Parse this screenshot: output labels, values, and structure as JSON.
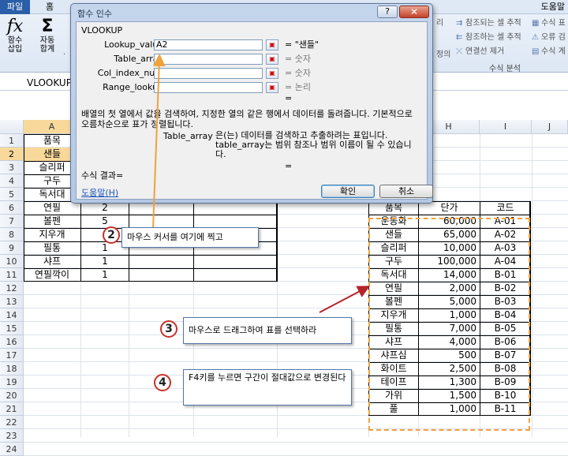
{
  "ribbon": {
    "tabs": {
      "file": "파일",
      "home": "홈",
      "help": "도움말"
    },
    "insert_function": [
      "함수",
      "삽입"
    ],
    "autosum": [
      "자동",
      "합계"
    ],
    "autosum_more": "·",
    "ribbon_stub_top": "리",
    "ribbon_stub_bottom": "정의",
    "trace_precedents": "참조되는 셀 추적",
    "trace_dependents": "참조하는 셀 추적",
    "remove_arrows": "연결선 제거",
    "show_formulas": "수식 표",
    "error_checking": "오류 검",
    "evaluate_formula": "수식 계",
    "group_label": "수식 분석"
  },
  "formula_bar": {
    "name_box": "VLOOKUP"
  },
  "columns": [
    "A",
    "H",
    "I",
    "J"
  ],
  "rows": [
    "1",
    "2",
    "3",
    "4",
    "5",
    "6",
    "7",
    "8",
    "9",
    "10",
    "11",
    "12",
    "13",
    "14",
    "15",
    "16",
    "17",
    "18",
    "19",
    "20",
    "21",
    "22",
    "23",
    "24"
  ],
  "table1": {
    "a": [
      "품목",
      "샌들",
      "슬리퍼",
      "구두",
      "독서대",
      "연필",
      "볼펜",
      "지우개",
      "필통",
      "샤프",
      "연필깍이"
    ],
    "b": [
      "2",
      "5",
      "",
      "1",
      "1",
      "1"
    ]
  },
  "table2": {
    "headers": [
      "품목",
      "단가",
      "코드"
    ],
    "rows": [
      [
        "운동화",
        "60,000",
        "A-01"
      ],
      [
        "샌들",
        "65,000",
        "A-02"
      ],
      [
        "슬리퍼",
        "10,000",
        "A-03"
      ],
      [
        "구두",
        "100,000",
        "A-04"
      ],
      [
        "독서대",
        "14,000",
        "B-01"
      ],
      [
        "연필",
        "2,000",
        "B-02"
      ],
      [
        "볼펜",
        "5,000",
        "B-03"
      ],
      [
        "지우개",
        "1,000",
        "B-04"
      ],
      [
        "필통",
        "7,000",
        "B-05"
      ],
      [
        "샤프",
        "4,000",
        "B-06"
      ],
      [
        "샤프심",
        "500",
        "B-07"
      ],
      [
        "화이트",
        "2,500",
        "B-08"
      ],
      [
        "테이프",
        "1,300",
        "B-09"
      ],
      [
        "가위",
        "1,500",
        "B-10"
      ],
      [
        "풀",
        "1,000",
        "B-11"
      ]
    ]
  },
  "dialog": {
    "title": "함수 인수",
    "help": "?",
    "close": "✕",
    "function_name": "VLOOKUP",
    "args": [
      {
        "label": "Lookup_value",
        "value": "A2",
        "result": "= \"샌들\""
      },
      {
        "label": "Table_array",
        "value": "",
        "result": "= 숫자"
      },
      {
        "label": "Col_index_num",
        "value": "",
        "result": "= 숫자"
      },
      {
        "label": "Range_lookup",
        "value": "",
        "result": "= 논리"
      }
    ],
    "eq": "=",
    "description": "배열의 첫 열에서 값을 검색하여, 지정한 열의 같은 행에서 데이터를 돌려줍니다. 기본적으로 오름차순으로 표가 정렬됩니다.",
    "arg_desc_name": "Table_array",
    "arg_desc": "은(는) 데이터를 검색하고 추출하려는 표입니다. table_array는 범위 참조나 범위 이름이 될 수 있습니다.",
    "result_label": "수식 결과=",
    "help_link": "도움말(H)",
    "ok": "확인",
    "cancel": "취소"
  },
  "callouts": {
    "c2": {
      "num": "2",
      "text": "마우스 커서를 여기에 찍고"
    },
    "c3": {
      "num": "3",
      "text": "마우스로 드래그하여 표를 선택하라"
    },
    "c4": {
      "num": "4",
      "text": "F4키를 누르면 구간이 절대값으로 변경된다"
    }
  },
  "colors": {
    "highlight": "#f9d99b",
    "annotation_arrow": "#b5232b",
    "pointer_arrow": "#f0a23b",
    "selection_border": "#f0a23b"
  }
}
